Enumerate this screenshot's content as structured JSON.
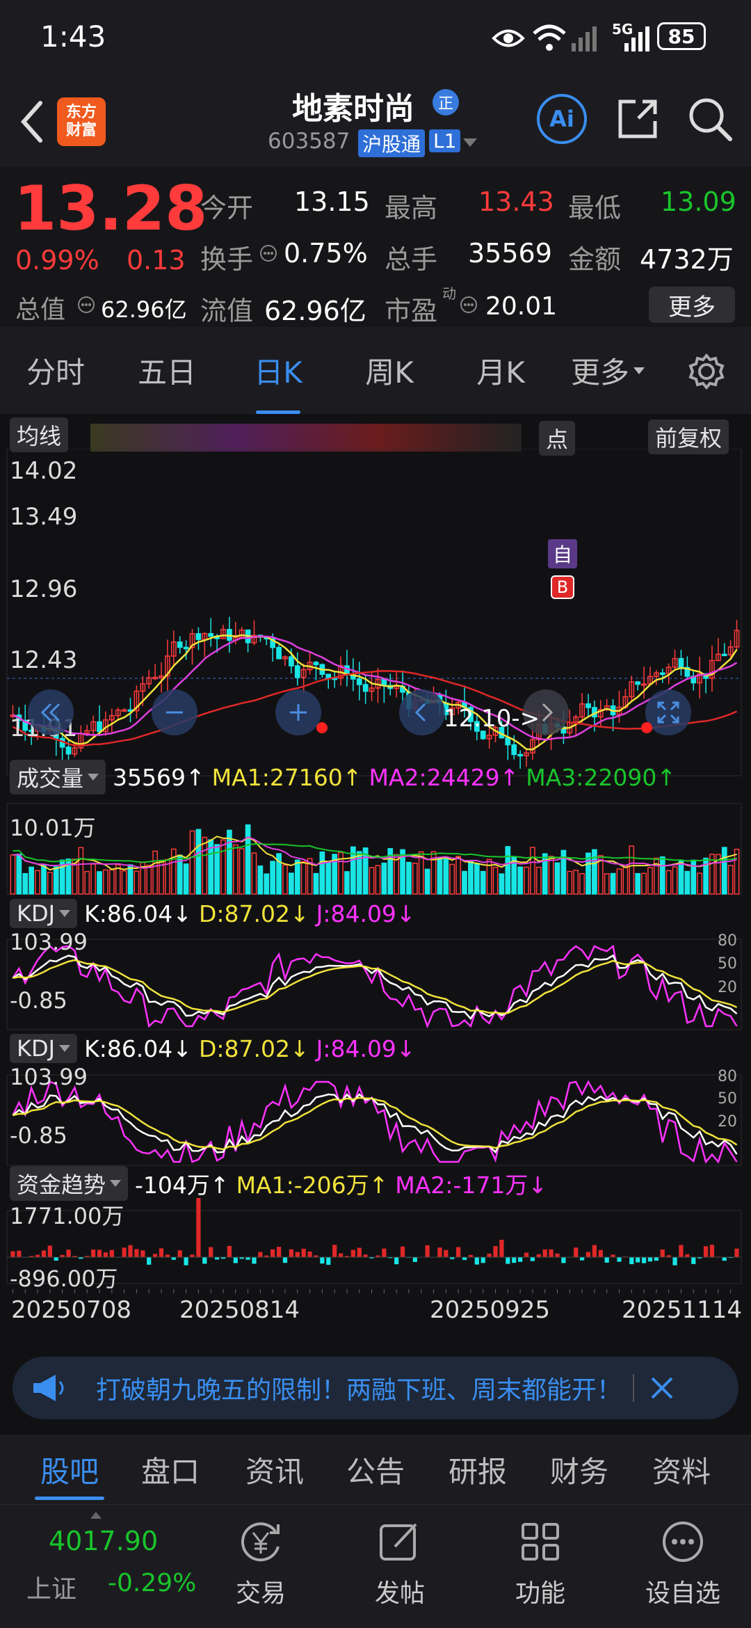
{
  "status": {
    "time": "1:43",
    "network": "5G",
    "battery": "85"
  },
  "header": {
    "logo_text": "东方\n财富",
    "stock_name": "地素时尚",
    "badge": "正",
    "code": "603587",
    "market_tag": "沪股通",
    "level_tag": "L1",
    "ai_label": "Ai"
  },
  "quote": {
    "price": "13.28",
    "change_pct": "0.99%",
    "change_amt": "0.13",
    "open_label": "今开",
    "open": "13.15",
    "high_label": "最高",
    "high": "13.43",
    "low_label": "最低",
    "low": "13.09",
    "turnover_label": "换手",
    "turnover": "0.75%",
    "volume_label": "总手",
    "volume": "35569",
    "amount_label": "金额",
    "amount": "4732万",
    "mcap_label": "总值",
    "mcap": "62.96亿",
    "float_label": "流值",
    "float": "62.96亿",
    "pe_label": "市盈",
    "pe_sup": "动",
    "pe": "20.01",
    "more": "更多"
  },
  "tabs": [
    "分时",
    "五日",
    "日K",
    "周K",
    "月K",
    "更多"
  ],
  "active_tab": 2,
  "kline": {
    "ma_chip": "均线",
    "point_chip": "点",
    "adjust_chip": "前复权",
    "y_labels": [
      "14.02",
      "13.49",
      "12.96",
      "12.43",
      "11.91"
    ],
    "tag_self": "自",
    "tag_buy": "B",
    "date_tip": "12.10->",
    "colors": {
      "up": "#ff3b3b",
      "down": "#19e5e5",
      "ma5": "#f2e33b",
      "ma10": "#e040e0",
      "ma20": "#e02828"
    }
  },
  "volume_panel": {
    "chip": "成交量",
    "value": "35569↑",
    "ma1": "MA1:27160↑",
    "ma2": "MA2:24429↑",
    "ma3": "MA3:22090↑",
    "max_label": "10.01万"
  },
  "kdj1": {
    "chip": "KDJ",
    "k": "K:86.04↓",
    "d": "D:87.02↓",
    "j": "J:84.09↓",
    "top": "103.99",
    "bottom": "-0.85",
    "levels": [
      "80",
      "50",
      "20"
    ]
  },
  "kdj2": {
    "chip": "KDJ",
    "k": "K:86.04↓",
    "d": "D:87.02↓",
    "j": "J:84.09↓",
    "top": "103.99",
    "bottom": "-0.85",
    "levels": [
      "80",
      "50",
      "20"
    ]
  },
  "fund_panel": {
    "chip": "资金趋势",
    "value": "-104万↑",
    "ma1": "MA1:-206万↑",
    "ma2": "MA2:-171万↓",
    "top": "1771.00万",
    "bottom": "-896.00万"
  },
  "dates": [
    "20250708",
    "20250814",
    "20250925",
    "20251114"
  ],
  "banner": {
    "text": "打破朝九晚五的限制！两融下班、周末都能开！"
  },
  "bottom_tabs": [
    "股吧",
    "盘口",
    "资讯",
    "公告",
    "研报",
    "财务",
    "资料"
  ],
  "footer": {
    "index_value": "4017.90",
    "index_name": "上证",
    "index_change": "-0.29%",
    "buttons": [
      "交易",
      "发帖",
      "功能",
      "设自选"
    ]
  }
}
